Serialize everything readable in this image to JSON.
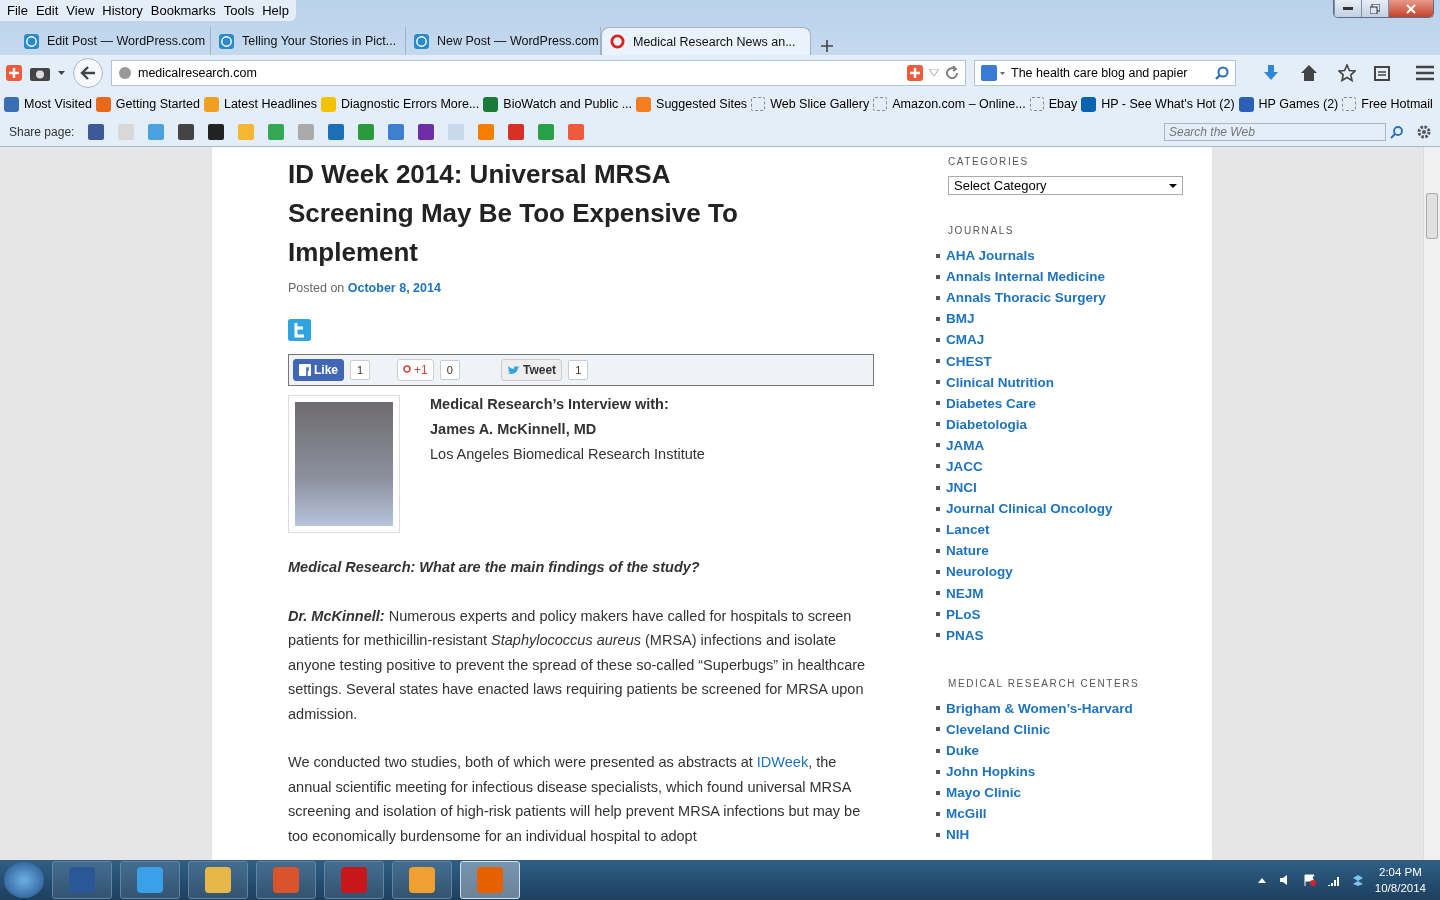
{
  "menu": [
    "File",
    "Edit",
    "View",
    "History",
    "Bookmarks",
    "Tools",
    "Help"
  ],
  "tabs": [
    {
      "title": "Edit Post — WordPress.com",
      "selected": false
    },
    {
      "title": "Telling Your Stories in Pict...",
      "selected": false
    },
    {
      "title": "New Post — WordPress.com",
      "selected": false
    },
    {
      "title": "Medical Research News an...",
      "selected": true
    }
  ],
  "address": {
    "url": "medicalresearch.com"
  },
  "search": {
    "value": "The health care blog and papier"
  },
  "bookmarks": [
    {
      "label": "Most Visited",
      "kind": "icon",
      "color": "#3a6fb5"
    },
    {
      "label": "Getting Started",
      "kind": "icon",
      "color": "#e8691c"
    },
    {
      "label": "Latest Headlines",
      "kind": "icon",
      "color": "#f0a020"
    },
    {
      "label": "Diagnostic Errors More...",
      "kind": "icon",
      "color": "#f2c200"
    },
    {
      "label": "BioWatch and Public ...",
      "kind": "icon",
      "color": "#1a7a3a"
    },
    {
      "label": "Suggested Sites",
      "kind": "icon",
      "color": "#f57c1f"
    },
    {
      "label": "Web Slice Gallery",
      "kind": "blank"
    },
    {
      "label": "Amazon.com – Online...",
      "kind": "blank"
    },
    {
      "label": "Ebay",
      "kind": "blank"
    },
    {
      "label": "HP - See What's Hot (2)",
      "kind": "icon",
      "color": "#0a62b0"
    },
    {
      "label": "HP Games (2)",
      "kind": "icon",
      "color": "#2c5fb7"
    },
    {
      "label": "Free Hotmail",
      "kind": "blank"
    }
  ],
  "share_bar": {
    "label": "Share page:",
    "icons": [
      {
        "color": "#3b5998"
      },
      {
        "color": "#d8d8d8"
      },
      {
        "color": "#4aa3df"
      },
      {
        "color": "#444444"
      },
      {
        "color": "#222222"
      },
      {
        "color": "#f7b733"
      },
      {
        "color": "#34a853"
      },
      {
        "color": "#aaaaaa"
      },
      {
        "color": "#1d6fb8"
      },
      {
        "color": "#2a9a3a"
      },
      {
        "color": "#3f7fd0"
      },
      {
        "color": "#6f2da8"
      },
      {
        "color": "#c9d8ea"
      },
      {
        "color": "#f57d00"
      },
      {
        "color": "#d93025"
      },
      {
        "color": "#27a046"
      },
      {
        "color": "#f05a3c"
      }
    ],
    "search_placeholder": "Search the Web"
  },
  "article": {
    "title": "ID Week 2014: Universal MRSA Screening May Be Too Expensive To Implement",
    "posted_prefix": "Posted on",
    "date": "October 8, 2014",
    "social": [
      {
        "label": "Like",
        "count": "1",
        "kind": "like"
      },
      {
        "label": "+1",
        "count": "0",
        "kind": "plusone"
      },
      {
        "label": "Tweet",
        "count": "1",
        "kind": "tweet"
      }
    ],
    "interview_heading": "Medical Research’s Interview with:",
    "person": "James A. McKinnell, MD",
    "institution": "Los Angeles Biomedical Research Institute",
    "question": "Medical Research: What are the main findings of the study?",
    "answer": "**Dr. McKinnell:** Numerous experts and policy makers have called for hospitals to screen patients for methicillin-resistant *Staphylococcus aureus* (MRSA) infections and isolate anyone testing positive to prevent the spread of these so-called “Superbugs” in healthcare settings. Several states have enacted laws requiring patients be screened for MRSA upon admission.",
    "para_before": "We conducted two studies, both of which were presented as abstracts at ",
    "para_link": "IDWeek",
    "para_after": ", the annual scientific meeting for infectious disease specialists, which found universal MRSA screening and isolation of high-risk patients will help prevent MRSA infections but may be too economically burdensome for an individual hospital to adopt"
  },
  "sidebar": {
    "categories_heading": "CATEGORIES",
    "category_select": "Select Category",
    "journals_heading": "JOURNALS",
    "journals": [
      "AHA Journals",
      "Annals Internal Medicine",
      "Annals Thoracic Surgery",
      "BMJ",
      "CMAJ",
      "CHEST",
      "Clinical Nutrition",
      "Diabetes Care",
      "Diabetologia",
      "JAMA",
      "JACC",
      "JNCI",
      "Journal Clinical Oncology",
      "Lancet",
      "Nature",
      "Neurology",
      "NEJM",
      "PLoS",
      "PNAS"
    ],
    "centers_heading": "MEDICAL RESEARCH CENTERS",
    "centers": [
      "Brigham & Women’s-Harvard",
      "Cleveland Clinic",
      "Duke",
      "John Hopkins",
      "Mayo Clinic",
      "McGill",
      "NIH"
    ]
  },
  "taskbar": {
    "apps": [
      {
        "color": "#2b5797",
        "selected": false
      },
      {
        "color": "#3aa0e8",
        "selected": false
      },
      {
        "color": "#e6b84a",
        "selected": false
      },
      {
        "color": "#d9532c",
        "selected": false
      },
      {
        "color": "#c8161d",
        "selected": false
      },
      {
        "color": "#f0a030",
        "selected": false
      },
      {
        "color": "#e66000",
        "selected": true
      }
    ],
    "time": "2:04 PM",
    "date": "10/8/2014"
  }
}
